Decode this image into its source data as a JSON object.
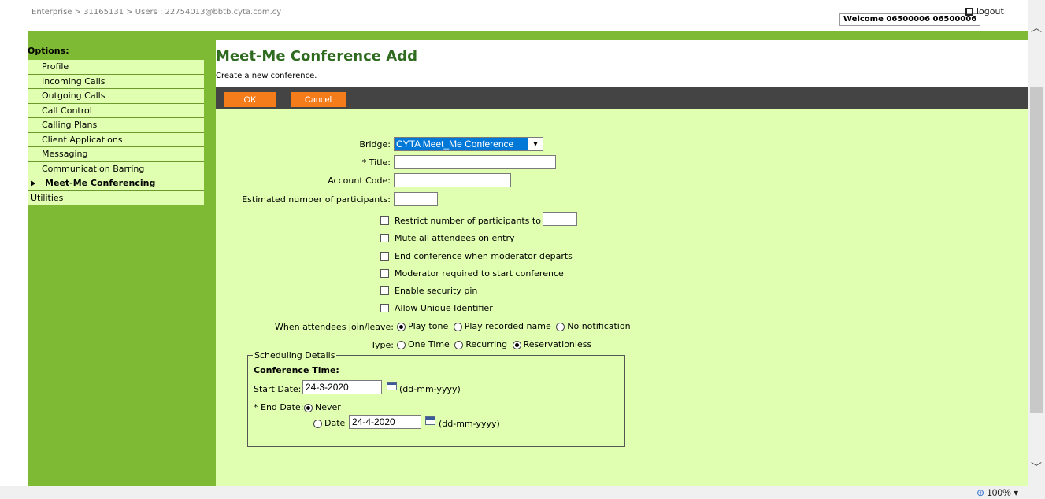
{
  "header": {
    "breadcrumb": "Enterprise > 31165131 > Users : 22754013@bbtb.cyta.com.cy",
    "welcome": "Welcome 06500006 06500006",
    "logout": "logout"
  },
  "sidebar": {
    "title": "Options:",
    "items": [
      "Profile",
      "Incoming Calls",
      "Outgoing Calls",
      "Call Control",
      "Calling Plans",
      "Client Applications",
      "Messaging",
      "Communication Barring",
      "Meet-Me Conferencing",
      "Utilities"
    ],
    "active_index": 8
  },
  "page": {
    "title": "Meet-Me Conference Add",
    "subtitle": "Create a new conference."
  },
  "toolbar": {
    "ok_label": "OK",
    "cancel_label": "Cancel"
  },
  "form": {
    "bridge_label": "Bridge:",
    "bridge_value": "CYTA Meet_Me Conference",
    "title_label": "* Title:",
    "title_value": "",
    "account_label": "Account Code:",
    "account_value": "",
    "participants_label": "Estimated number of participants:",
    "participants_value": "",
    "checkboxes": [
      {
        "label": "Restrict number of participants to",
        "checked": false
      },
      {
        "label": "Mute all attendees on entry",
        "checked": false
      },
      {
        "label": "End conference when moderator departs",
        "checked": false
      },
      {
        "label": "Moderator required to start conference",
        "checked": false
      },
      {
        "label": "Enable security pin",
        "checked": false
      },
      {
        "label": "Allow Unique Identifier",
        "checked": false
      }
    ],
    "restrict_value": "",
    "join_label": "When attendees join/leave:",
    "join_options": [
      "Play tone",
      "Play recorded name",
      "No notification"
    ],
    "join_selected": "Play tone",
    "type_label": "Type:",
    "type_options": [
      "One Time",
      "Recurring",
      "Reservationless"
    ],
    "type_selected": "Reservationless"
  },
  "scheduling": {
    "legend": "Scheduling Details",
    "conference_time": "Conference Time:",
    "start_label": "Start Date:",
    "start_value": "24-3-2020",
    "date_format": "(dd-mm-yyyy)",
    "end_label": "* End Date:",
    "never_label": "Never",
    "date_label": "Date",
    "end_value": "24-4-2020",
    "end_selected": "Never"
  },
  "statusbar": {
    "zoom": "100%"
  },
  "colors": {
    "green": "#7fba35",
    "light_green": "#e1ffb0",
    "orange": "#f47c1b",
    "title_green": "#2e6b1f"
  }
}
